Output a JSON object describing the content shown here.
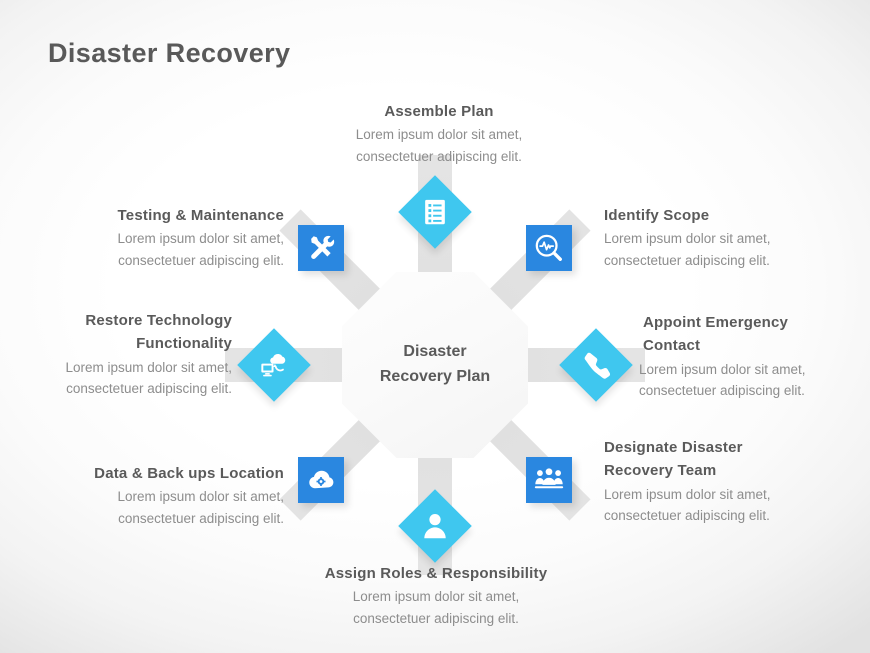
{
  "slide": {
    "title": "Disaster Recovery",
    "hub": {
      "line1": "Disaster",
      "line2": "Recovery Plan"
    },
    "accent_cyan": "#3fc7ef",
    "accent_blue": "#2a87e0",
    "title_color": "#595959",
    "body_color": "#8d8d8d"
  },
  "nodes": [
    {
      "id": "assemble-plan",
      "title": "Assemble Plan",
      "body_line1": "Lorem ipsum dolor sit amet,",
      "body_line2": "consectetuer adipiscing elit.",
      "icon": "clipboard-list-icon",
      "badge_shape": "diamond",
      "badge_color": "#3fc7ef",
      "position": "top"
    },
    {
      "id": "identify-scope",
      "title": "Identify Scope",
      "body_line1": "Lorem ipsum dolor sit amet,",
      "body_line2": "consectetuer adipiscing elit.",
      "icon": "magnifier-pulse-icon",
      "badge_shape": "square",
      "badge_color": "#2a87e0",
      "position": "top-right"
    },
    {
      "id": "appoint-emergency-contact",
      "title_line1": "Appoint Emergency",
      "title_line2": "Contact",
      "body_line1": "Lorem ipsum dolor sit amet,",
      "body_line2": "consectetuer adipiscing elit.",
      "icon": "phone-icon",
      "badge_shape": "diamond",
      "badge_color": "#3fc7ef",
      "position": "right"
    },
    {
      "id": "designate-disaster-recovery-team",
      "title_line1": "Designate Disaster",
      "title_line2": "Recovery Team",
      "body_line1": "Lorem ipsum dolor sit amet,",
      "body_line2": "consectetuer adipiscing elit.",
      "icon": "team-group-icon",
      "badge_shape": "square",
      "badge_color": "#2a87e0",
      "position": "bottom-right"
    },
    {
      "id": "assign-roles-responsibility",
      "title": "Assign Roles & Responsibility",
      "body_line1": "Lorem ipsum dolor sit amet,",
      "body_line2": "consectetuer adipiscing elit.",
      "icon": "person-icon",
      "badge_shape": "diamond",
      "badge_color": "#3fc7ef",
      "position": "bottom"
    },
    {
      "id": "data-backups-location",
      "title": "Data & Back ups Location",
      "body_line1": "Lorem ipsum dolor sit amet,",
      "body_line2": "consectetuer adipiscing elit.",
      "icon": "cloud-sync-icon",
      "badge_shape": "square",
      "badge_color": "#2a87e0",
      "position": "bottom-left"
    },
    {
      "id": "restore-technology-functionality",
      "title_line1": "Restore Technology",
      "title_line2": "Functionality",
      "body_line1": "Lorem ipsum dolor sit amet,",
      "body_line2": "consectetuer adipiscing elit.",
      "icon": "cloud-computer-sync-icon",
      "badge_shape": "diamond",
      "badge_color": "#3fc7ef",
      "position": "left"
    },
    {
      "id": "testing-maintenance",
      "title": "Testing & Maintenance",
      "body_line1": "Lorem ipsum dolor sit amet,",
      "body_line2": "consectetuer adipiscing elit.",
      "icon": "tools-icon",
      "badge_shape": "square",
      "badge_color": "#2a87e0",
      "position": "top-left"
    }
  ]
}
